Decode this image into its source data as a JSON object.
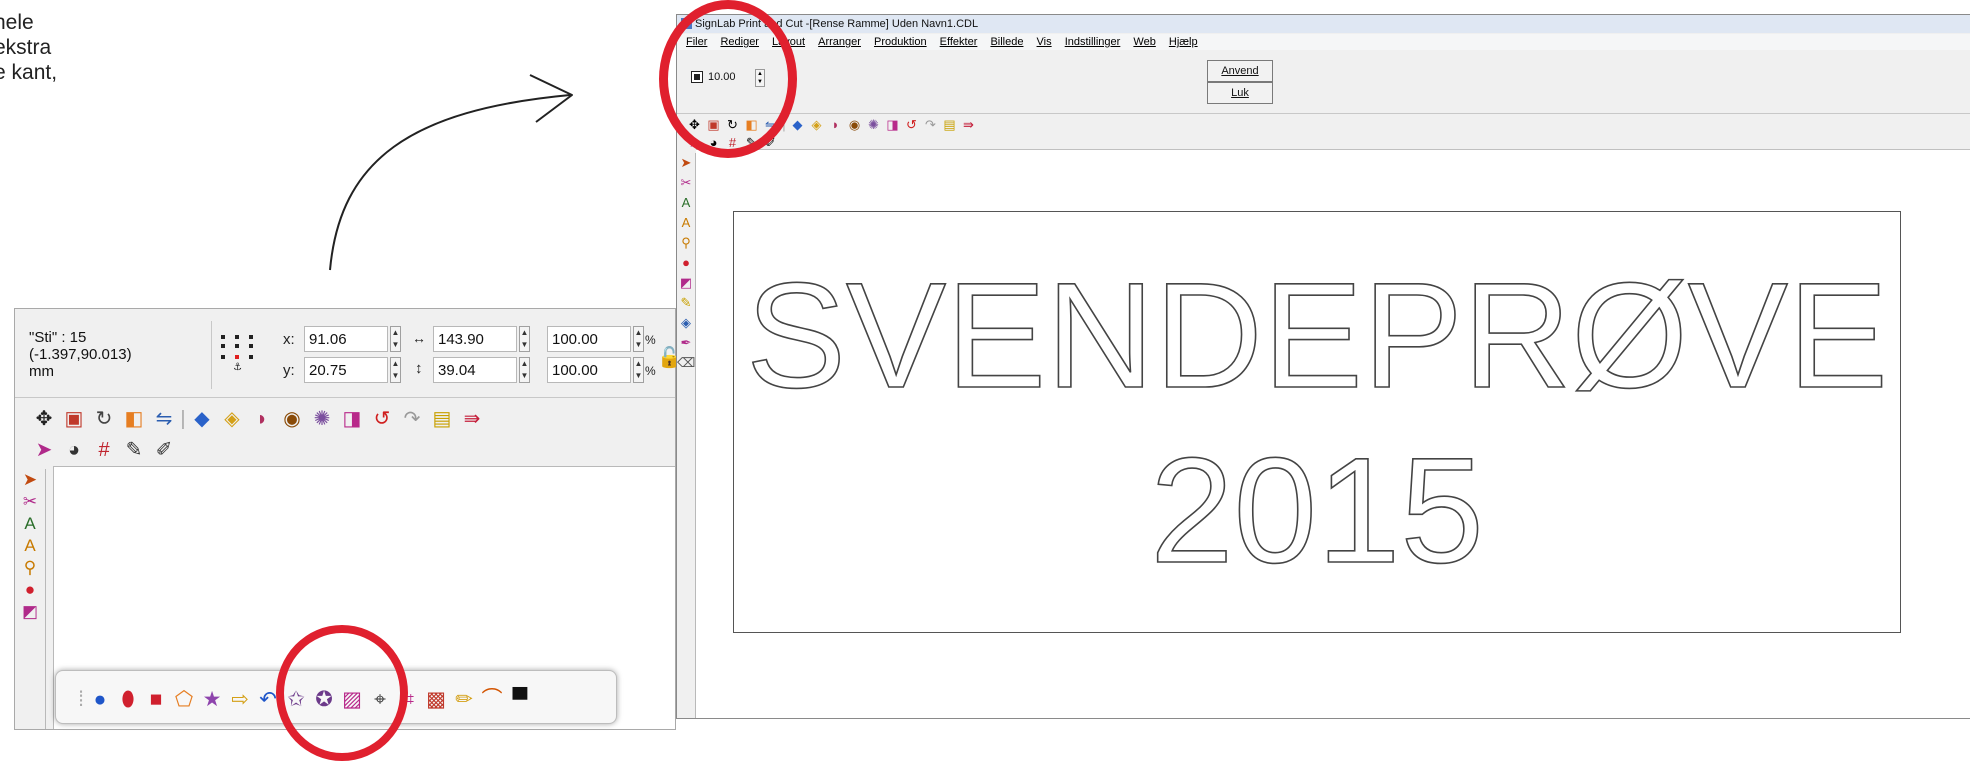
{
  "annotation": {
    "lines": [
      "hele",
      "ekstra",
      "e kant,"
    ]
  },
  "left_panel": {
    "info": {
      "name": "\"Sti\" : 15",
      "coords": "(-1.397,90.013)",
      "unit": "mm"
    },
    "fields": {
      "x_label": "x:",
      "x_value": "91.06",
      "y_label": "y:",
      "y_value": "20.75",
      "width_value": "143.90",
      "height_value": "39.04",
      "scale_w_value": "100.00",
      "scale_h_value": "100.00",
      "percent": "%"
    },
    "toolbar_icons": [
      "move-icon",
      "node-icon",
      "rotate-icon",
      "mirror-icon",
      "weld-icon",
      "bevel-icon",
      "fill-icon",
      "gradient-icon",
      "shadow-icon",
      "outline-icon",
      "contour-icon",
      "undo-icon",
      "redo-icon",
      "group-icon",
      "exit-icon"
    ],
    "shape_bar_icons": [
      "circle-icon",
      "balloon-icon",
      "square-icon",
      "pentagon-icon",
      "star-icon",
      "arrow-icon",
      "arc-icon",
      "star-frame-icon",
      "star-frame-2-icon",
      "image-icon",
      "crosshair-icon",
      "crop-icon",
      "pattern-icon",
      "ruler-icon",
      "rainbow-icon",
      "shape-icon"
    ]
  },
  "window": {
    "title": "SignLab Print and Cut -[Rense Ramme] Uden Navn1.CDL",
    "menus": [
      "Filer",
      "Rediger",
      "Layout",
      "Arranger",
      "Produktion",
      "Effekter",
      "Billede",
      "Vis",
      "Indstillinger",
      "Web",
      "Hjælp"
    ],
    "offset_value": "10.00",
    "apply_button": "Anvend",
    "close_button": "Luk",
    "canvas_text_line1": "SVENDEPRØVE",
    "canvas_text_line2": "2015"
  },
  "colors": {
    "highlight": "#e0202e"
  }
}
